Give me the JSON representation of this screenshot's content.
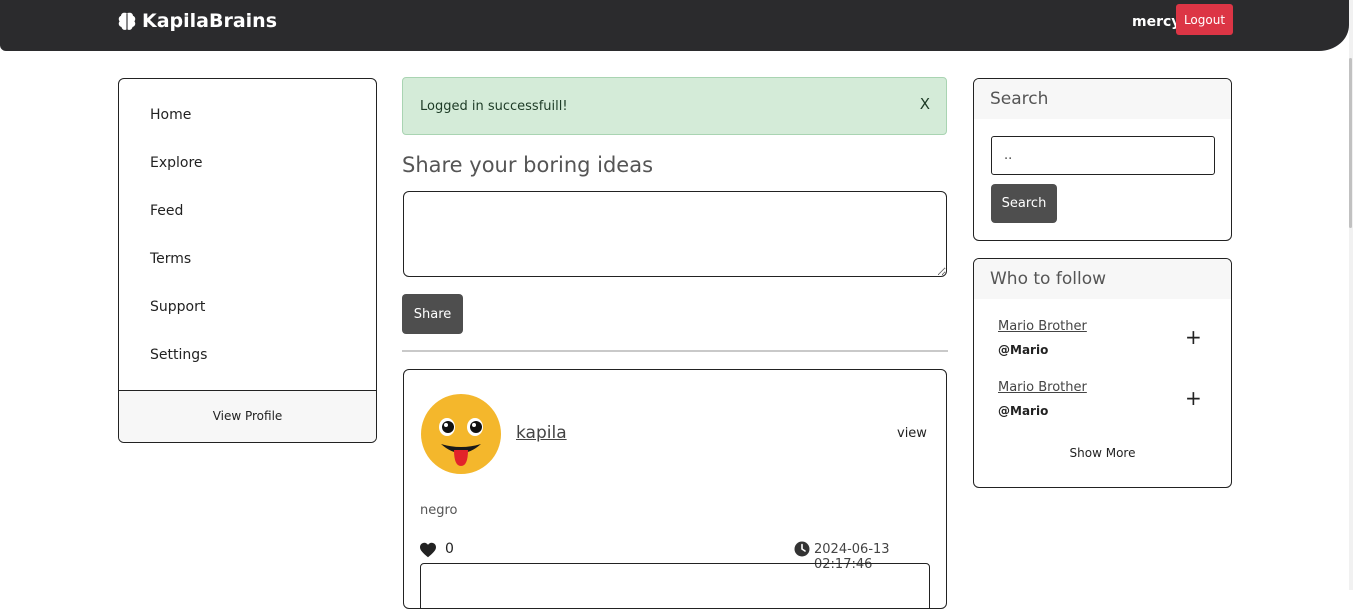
{
  "navbar": {
    "brand": "KapilaBrains",
    "brand_icon": "brain-icon",
    "username": "mercy",
    "logout_label": "Logout",
    "logout_color": "#dc3545"
  },
  "sidebar": {
    "items": [
      {
        "label": "Home"
      },
      {
        "label": "Explore"
      },
      {
        "label": "Feed"
      },
      {
        "label": "Terms"
      },
      {
        "label": "Support"
      },
      {
        "label": "Settings"
      }
    ],
    "footer_label": "View Profile"
  },
  "alert": {
    "message": "Logged in successfuill!",
    "close_label": "X"
  },
  "composer": {
    "title": "Share your boring ideas",
    "placeholder": "",
    "button_label": "Share"
  },
  "post": {
    "username": "kapila",
    "view_label": "view",
    "content": "negro",
    "likes": "0",
    "timestamp": "2024-06-13 02:17:46"
  },
  "search": {
    "header": "Search",
    "value": "..",
    "button_label": "Search"
  },
  "follow": {
    "header": "Who to follow",
    "users": [
      {
        "name": "Mario Brother",
        "handle": "@Mario"
      },
      {
        "name": "Mario Brother",
        "handle": "@Mario"
      }
    ],
    "add_label": "+",
    "show_more_label": "Show More"
  }
}
